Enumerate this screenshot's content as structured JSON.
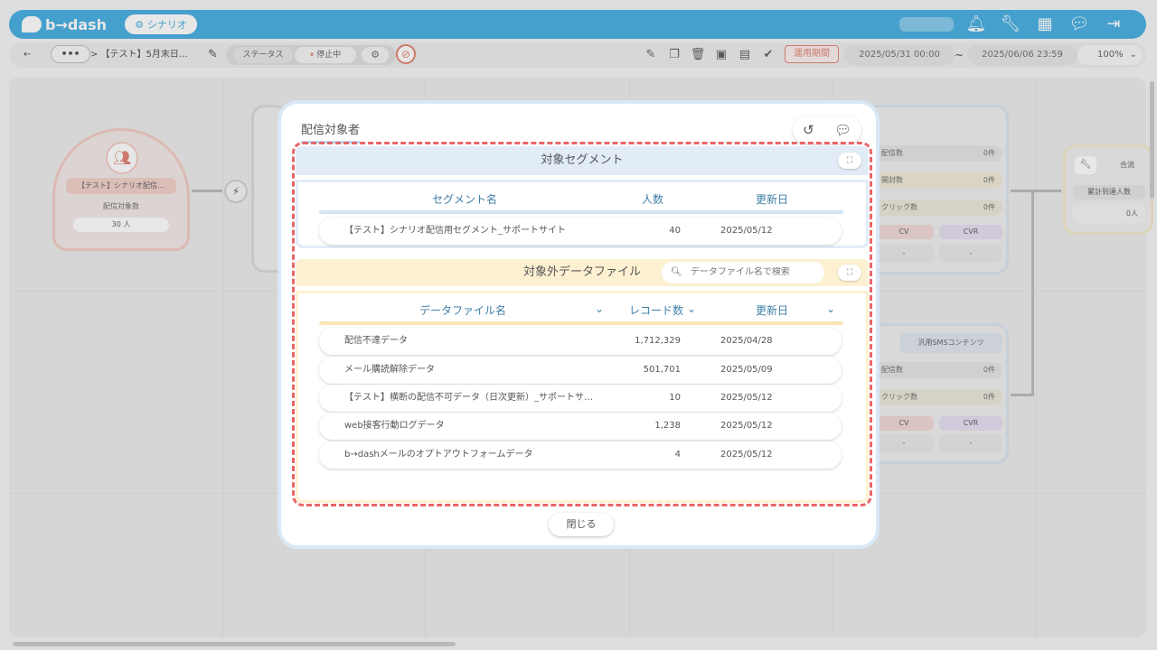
{
  "header": {
    "logo_text": "b→dash",
    "scenario_label": "シナリオ",
    "icons": [
      "bell-icon",
      "wrench-icon",
      "apps-grid-icon",
      "chat-icon",
      "logout-icon"
    ]
  },
  "toolbar": {
    "back_icon": "←",
    "more_label": "•••",
    "breadcrumb": "> 【テスト】5月末日…",
    "status_label": "ステータス",
    "status_value": "停止中",
    "period_label": "運用期間",
    "start_date": "2025/05/31 00:00",
    "tilde": "~",
    "end_date": "2025/06/06 23:59",
    "zoom": "100%"
  },
  "background": {
    "start_node_title": "【テスト】シナリオ配信…",
    "start_node_label": "配信対象数",
    "start_node_value": "30 人",
    "right_node_rows": [
      {
        "label": "配信数",
        "value": "0件"
      },
      {
        "label": "開封数",
        "value": "0件"
      },
      {
        "label": "クリック数",
        "value": "0件"
      }
    ],
    "cv_label": "CV",
    "cvr_label": "CVR",
    "dash": "-",
    "sms_title": "汎用SMSコンテンツ",
    "sms_rows": [
      {
        "label": "配信数",
        "value": "0件"
      },
      {
        "label": "クリック数",
        "value": "0件"
      }
    ],
    "merge_title": "合流",
    "merge_label": "累計到達人数",
    "merge_value": "0人"
  },
  "modal": {
    "title": "配信対象者",
    "segment_section": {
      "title": "対象セグメント",
      "columns": [
        "セグメント名",
        "人数",
        "更新日"
      ],
      "rows": [
        {
          "name": "【テスト】シナリオ配信用セグメント_サポートサイト",
          "count": "40",
          "date": "2025/05/12"
        }
      ]
    },
    "excluded_section": {
      "title": "対象外データファイル",
      "search_placeholder": "データファイル名で検索",
      "columns": [
        "データファイル名",
        "レコード数",
        "更新日"
      ],
      "rows": [
        {
          "name": "配信不達データ",
          "count": "1,712,329",
          "date": "2025/04/28"
        },
        {
          "name": "メール購読解除データ",
          "count": "501,701",
          "date": "2025/05/09"
        },
        {
          "name": "【テスト】横断の配信不可データ（日次更新）_サポートサ…",
          "count": "10",
          "date": "2025/05/12"
        },
        {
          "name": "web接客行動ログデータ",
          "count": "1,238",
          "date": "2025/05/12"
        },
        {
          "name": "b→dashメールのオプトアウトフォームデータ",
          "count": "4",
          "date": "2025/05/12"
        }
      ]
    },
    "close_label": "閉じる"
  },
  "colors": {
    "brand": "#3aa9e0",
    "segment_header": "#e1ecf7",
    "excluded_header": "#fdf1d2",
    "highlight_dash": "#e8666a",
    "header_text": "#3f7fa6"
  }
}
